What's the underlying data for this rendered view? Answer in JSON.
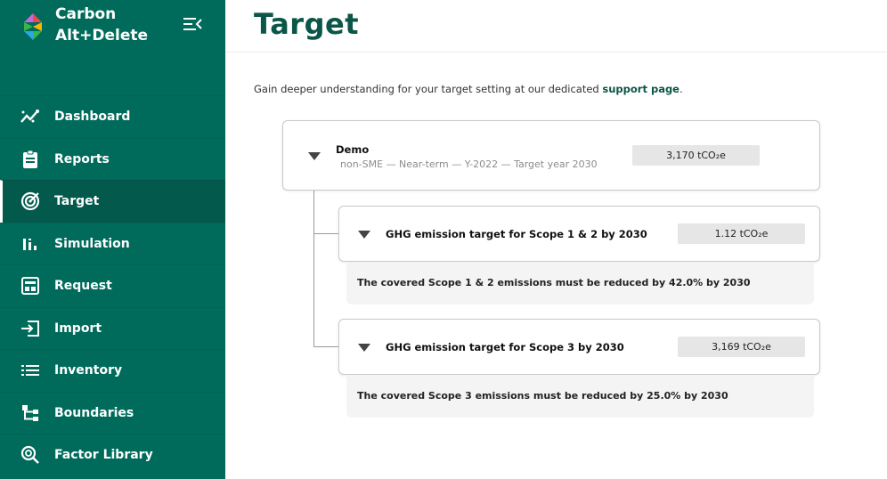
{
  "brand": {
    "line1": "Carbon",
    "line2": "Alt+Delete",
    "logo_colors": [
      "#e94b4b",
      "#f5b800",
      "#2ea7e0",
      "#3ab54a"
    ]
  },
  "sidebar": {
    "items": [
      {
        "label": "Dashboard",
        "icon": "chart-line-icon",
        "active": false
      },
      {
        "label": "Reports",
        "icon": "clipboard-icon",
        "active": false
      },
      {
        "label": "Target",
        "icon": "target-icon",
        "active": true
      },
      {
        "label": "Simulation",
        "icon": "bar-chart-icon",
        "active": false
      },
      {
        "label": "Request",
        "icon": "request-grid-icon",
        "active": false
      },
      {
        "label": "Import",
        "icon": "import-icon",
        "active": false
      },
      {
        "label": "Inventory",
        "icon": "list-icon",
        "active": false
      },
      {
        "label": "Boundaries",
        "icon": "hierarchy-icon",
        "active": false
      },
      {
        "label": "Factor Library",
        "icon": "search-library-icon",
        "active": false
      }
    ]
  },
  "main": {
    "title": "Target",
    "intro_text": "Gain deeper understanding for your target setting at our dedicated ",
    "intro_link": "support page",
    "intro_end": ".",
    "root": {
      "title": "Demo",
      "subtitle": "non-SME — Near-term — Y-2022 — Target year 2030",
      "value": "3,170 tCO₂e"
    },
    "targets": [
      {
        "title": "GHG emission target for Scope 1 & 2 by 2030",
        "value": "1.12 tCO₂e",
        "detail": "The covered Scope 1 & 2 emissions must be reduced by 42.0% by 2030"
      },
      {
        "title": "GHG emission target for Scope 3 by 2030",
        "value": "3,169 tCO₂e",
        "detail": "The covered Scope 3 emissions must be reduced by 25.0% by 2030"
      }
    ]
  },
  "colors": {
    "sidebar_bg": "#006b5b",
    "sidebar_active": "#03594c",
    "accent": "#0b5648"
  }
}
